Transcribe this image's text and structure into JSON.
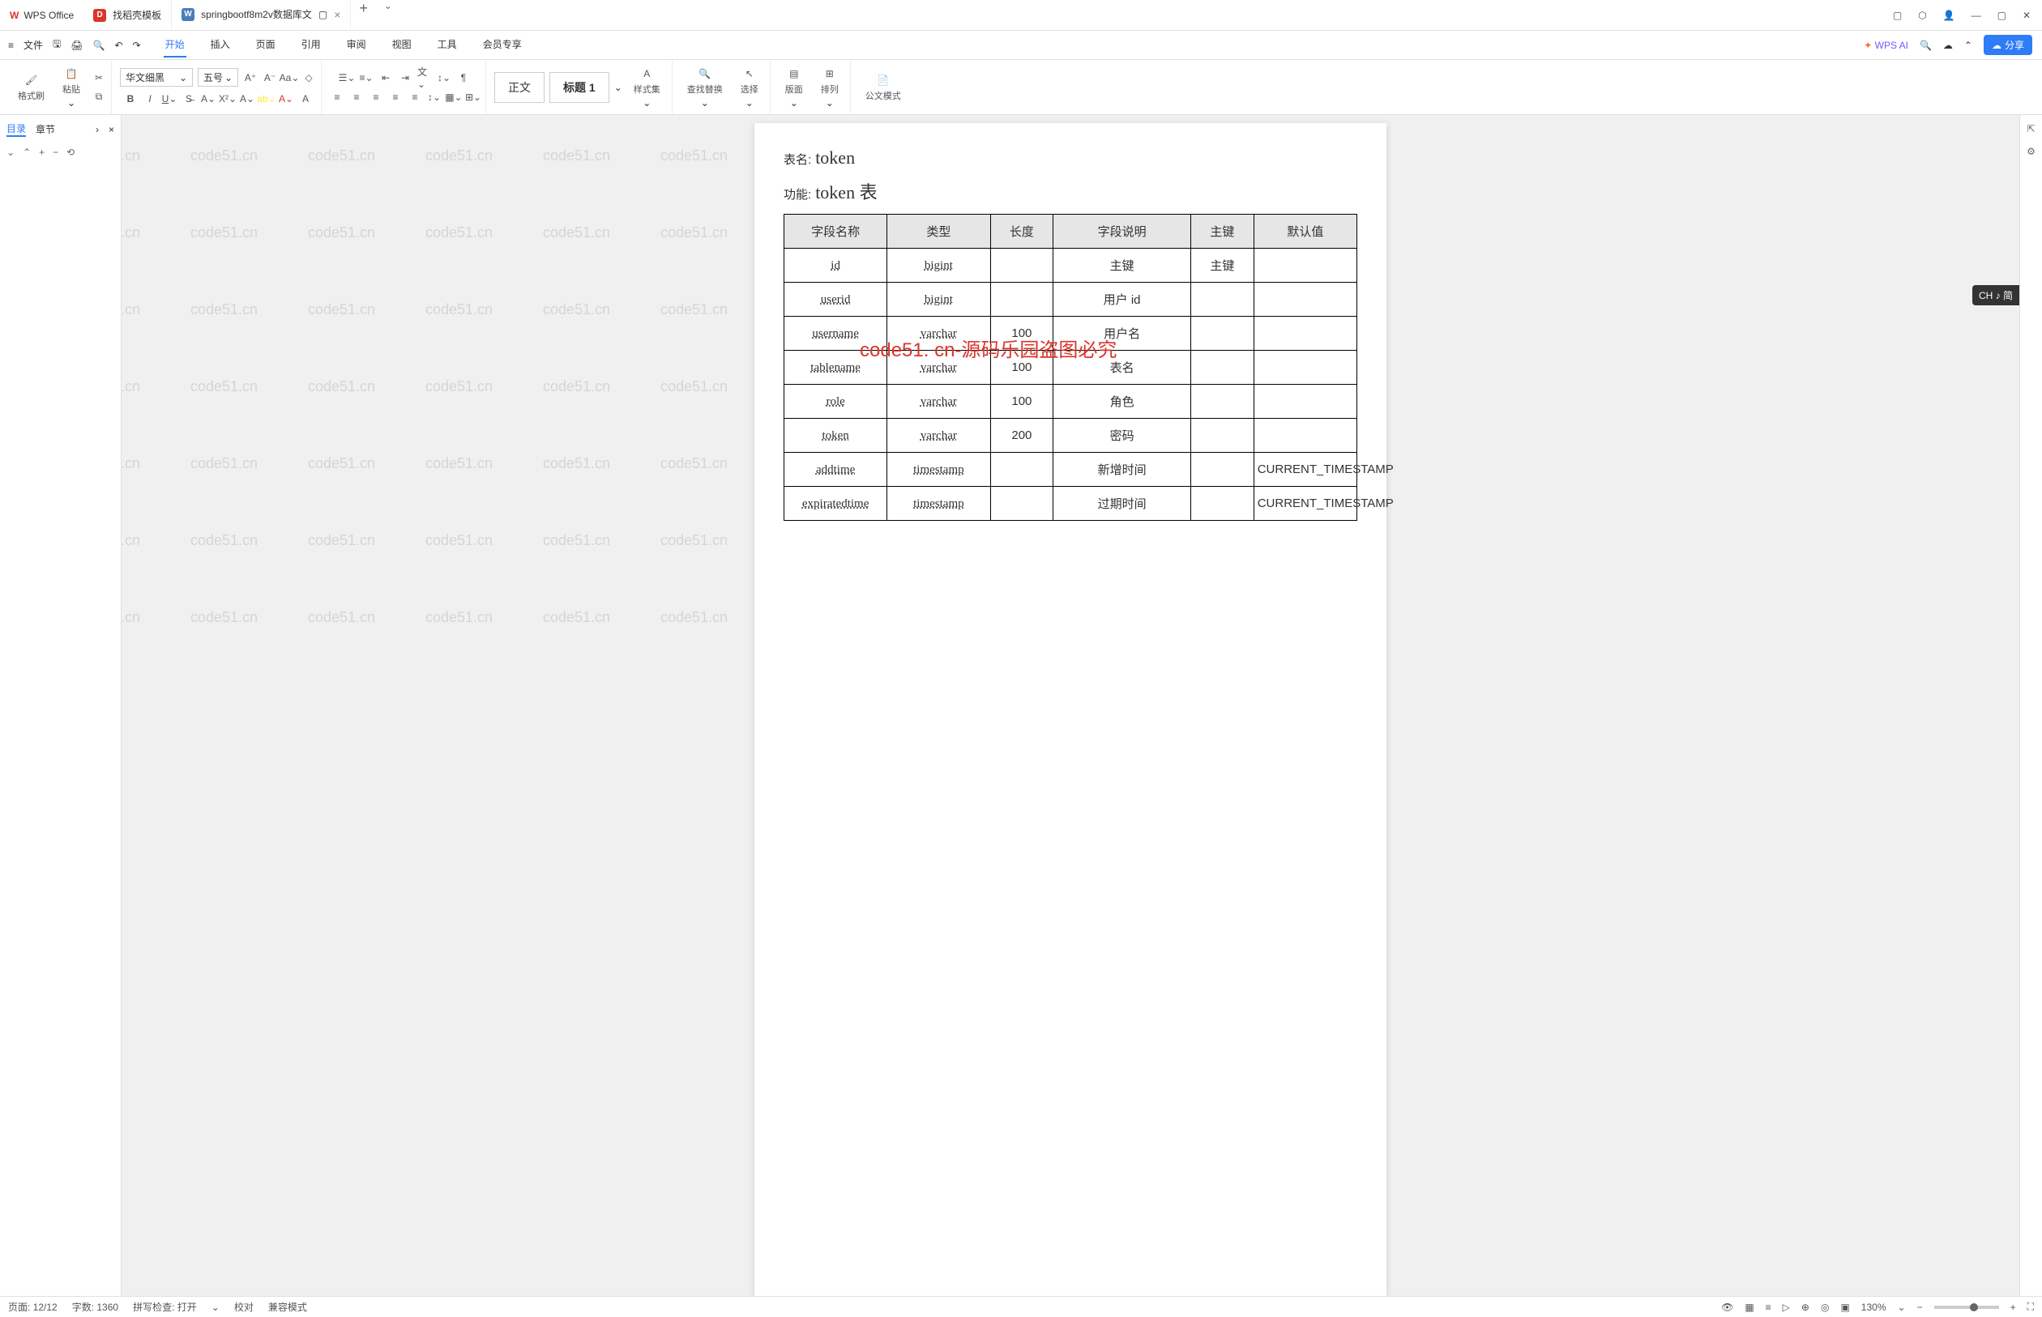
{
  "app": {
    "name": "WPS Office"
  },
  "tabs": [
    {
      "label": "找稻壳模板",
      "type": "d"
    },
    {
      "label": "springbootf8m2v数据库文",
      "type": "w",
      "active": true
    }
  ],
  "menu": {
    "file": "文件",
    "items": [
      "开始",
      "插入",
      "页面",
      "引用",
      "审阅",
      "视图",
      "工具",
      "会员专享"
    ],
    "active": "开始",
    "wps_ai": "WPS AI",
    "share": "分享"
  },
  "ribbon": {
    "format_painter": "格式刷",
    "paste": "粘贴",
    "font_name": "华文细黑",
    "font_size": "五号",
    "style_normal": "正文",
    "style_h1": "标题 1",
    "styles": "样式集",
    "find_replace": "查找替换",
    "select": "选择",
    "layout": "版面",
    "arrange": "排列",
    "doc_mode": "公文模式"
  },
  "sidebar": {
    "toc": "目录",
    "chapter": "章节"
  },
  "doc": {
    "label_name": "表名:",
    "table_name": "token",
    "label_func": "功能:",
    "table_func": "token 表",
    "headers": [
      "字段名称",
      "类型",
      "长度",
      "字段说明",
      "主键",
      "默认值"
    ],
    "rows": [
      {
        "name": "id",
        "type": "bigint",
        "len": "",
        "desc": "主键",
        "pk": "主键",
        "def": ""
      },
      {
        "name": "userid",
        "type": "bigint",
        "len": "",
        "desc": "用户 id",
        "pk": "",
        "def": ""
      },
      {
        "name": "username",
        "type": "varchar",
        "len": "100",
        "desc": "用户名",
        "pk": "",
        "def": ""
      },
      {
        "name": "tablename",
        "type": "varchar",
        "len": "100",
        "desc": "表名",
        "pk": "",
        "def": ""
      },
      {
        "name": "role",
        "type": "varchar",
        "len": "100",
        "desc": "角色",
        "pk": "",
        "def": ""
      },
      {
        "name": "token",
        "type": "varchar",
        "len": "200",
        "desc": "密码",
        "pk": "",
        "def": ""
      },
      {
        "name": "addtime",
        "type": "timestamp",
        "len": "",
        "desc": "新增时间",
        "pk": "",
        "def": "CURRENT_TIMESTAMP"
      },
      {
        "name": "expiratedtime",
        "type": "timestamp",
        "len": "",
        "desc": "过期时间",
        "pk": "",
        "def": "CURRENT_TIMESTAMP"
      }
    ],
    "overlay": "code51. cn-源码乐园盗图必究",
    "watermark": "code51.cn",
    "ime": "CH ♪ 简"
  },
  "status": {
    "page": "页面: 12/12",
    "words": "字数: 1360",
    "spell": "拼写检查: 打开",
    "proof": "校对",
    "compat": "兼容模式",
    "zoom": "130%"
  }
}
